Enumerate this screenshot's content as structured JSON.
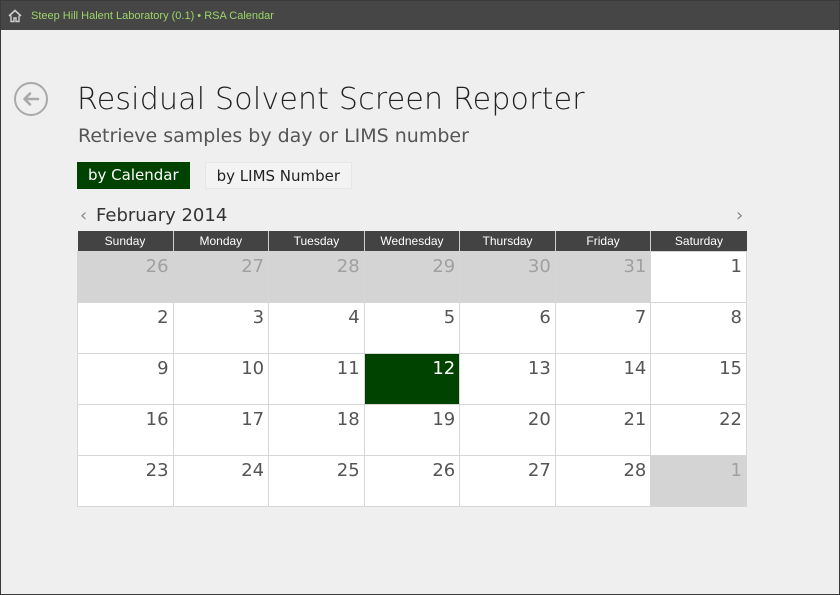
{
  "app": {
    "title": "Steep Hill Halent Laboratory (0.1) • RSA Calendar",
    "accent": "#9ed36a"
  },
  "page": {
    "title": "Residual Solvent Screen Reporter",
    "subtitle": "Retrieve samples by day or LIMS number"
  },
  "tabs": [
    {
      "label": "by Calendar",
      "active": true
    },
    {
      "label": "by LIMS Number",
      "active": false
    }
  ],
  "calendar": {
    "month_label": "February 2014",
    "prev": "‹",
    "next": "›",
    "weekdays": [
      "Sunday",
      "Monday",
      "Tuesday",
      "Wednesday",
      "Thursday",
      "Friday",
      "Saturday"
    ],
    "weeks": [
      [
        {
          "d": "26",
          "state": "other"
        },
        {
          "d": "27",
          "state": "other"
        },
        {
          "d": "28",
          "state": "other"
        },
        {
          "d": "29",
          "state": "other"
        },
        {
          "d": "30",
          "state": "other"
        },
        {
          "d": "31",
          "state": "other"
        },
        {
          "d": "1",
          "state": "current"
        }
      ],
      [
        {
          "d": "2",
          "state": "current"
        },
        {
          "d": "3",
          "state": "current"
        },
        {
          "d": "4",
          "state": "current"
        },
        {
          "d": "5",
          "state": "current"
        },
        {
          "d": "6",
          "state": "current"
        },
        {
          "d": "7",
          "state": "current"
        },
        {
          "d": "8",
          "state": "current"
        }
      ],
      [
        {
          "d": "9",
          "state": "current"
        },
        {
          "d": "10",
          "state": "current"
        },
        {
          "d": "11",
          "state": "current"
        },
        {
          "d": "12",
          "state": "selected"
        },
        {
          "d": "13",
          "state": "current"
        },
        {
          "d": "14",
          "state": "current"
        },
        {
          "d": "15",
          "state": "current"
        }
      ],
      [
        {
          "d": "16",
          "state": "current"
        },
        {
          "d": "17",
          "state": "current"
        },
        {
          "d": "18",
          "state": "current"
        },
        {
          "d": "19",
          "state": "current"
        },
        {
          "d": "20",
          "state": "current"
        },
        {
          "d": "21",
          "state": "current"
        },
        {
          "d": "22",
          "state": "current"
        }
      ],
      [
        {
          "d": "23",
          "state": "current"
        },
        {
          "d": "24",
          "state": "current"
        },
        {
          "d": "25",
          "state": "current"
        },
        {
          "d": "26",
          "state": "current"
        },
        {
          "d": "27",
          "state": "current"
        },
        {
          "d": "28",
          "state": "current"
        },
        {
          "d": "1",
          "state": "other"
        }
      ]
    ],
    "selected_color": "#004200"
  },
  "icons": {
    "home": "home-icon",
    "back": "back-arrow-icon"
  }
}
